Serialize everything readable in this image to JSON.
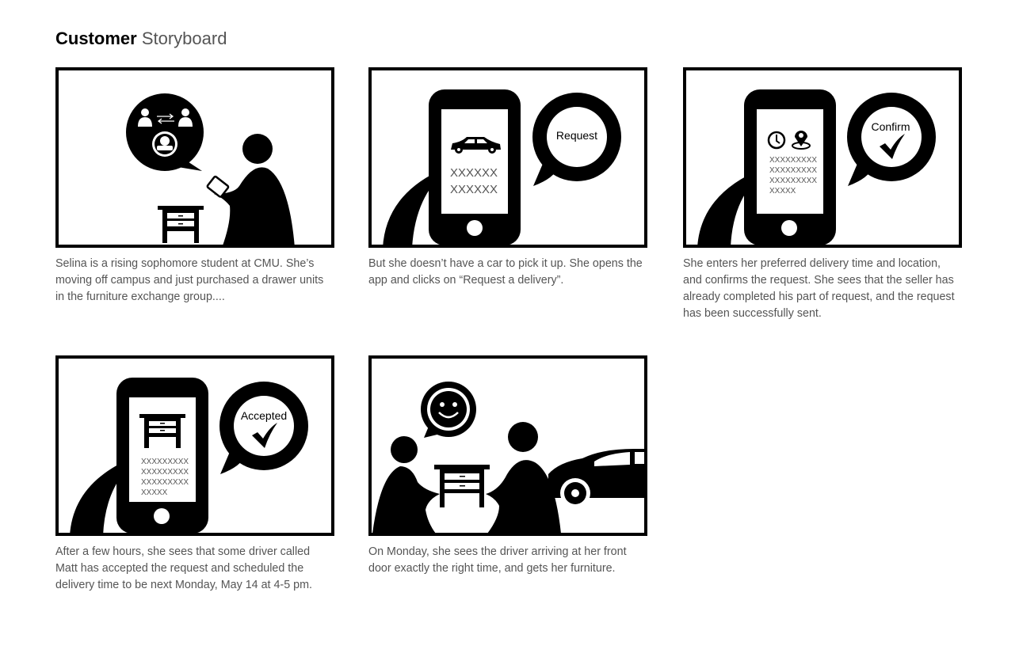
{
  "page": {
    "title_bold": "Customer",
    "title_rest": "Storyboard"
  },
  "panels": [
    {
      "caption": "Selina is a rising sophomore student at CMU. She’s moving off campus and just purchased a drawer units in the furniture exchange group...."
    },
    {
      "caption": "But she doesn’t have a car to pick it up. She opens the app and clicks on “Request a delivery”.",
      "bubble": "Request",
      "screen_lines": [
        "XXXXXX",
        "XXXXXX"
      ]
    },
    {
      "caption": " She enters her preferred delivery time and location, and confirms the request. She sees that the seller has already completed his part of request, and the request has been successfully sent.",
      "bubble": "Confirm",
      "screen_lines": [
        "XXXXXXXXX",
        "XXXXXXXXX",
        "XXXXXXXXX",
        "XXXXX"
      ]
    },
    {
      "caption": "After a few hours, she sees that some driver called Matt has accepted the request and scheduled the delivery time to be next Monday, May 14 at 4-5 pm.",
      "bubble": "Accepted",
      "screen_lines": [
        "XXXXXXXXX",
        "XXXXXXXXX",
        "XXXXXXXXX",
        "XXXXX"
      ]
    },
    {
      "caption": "On Monday, she sees the driver arriving at her front door exactly the right time, and gets her furniture."
    }
  ]
}
